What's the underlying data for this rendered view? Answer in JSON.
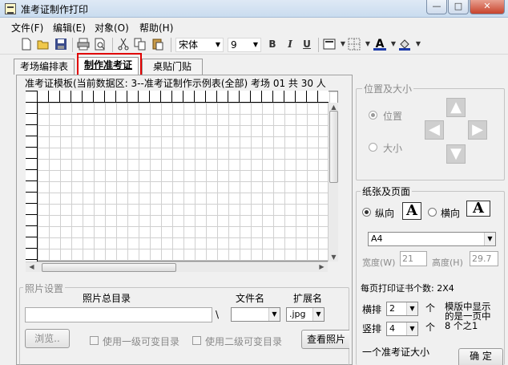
{
  "window": {
    "title": "准考证制作打印",
    "minimize": "—",
    "maximize": "□",
    "close": "✕"
  },
  "menu": [
    "文件(F)",
    "编辑(E)",
    "对象(O)",
    "帮助(H)"
  ],
  "toolbar": {
    "font": "宋体",
    "size": "9",
    "bold": "B",
    "italic": "I",
    "underline": "U",
    "font_color": "A"
  },
  "icons": {
    "new": "new-file-icon",
    "open": "open-folder-icon",
    "save": "save-icon",
    "print": "print-icon",
    "preview": "print-preview-icon",
    "cut": "cut-icon",
    "copy": "copy-icon",
    "paste": "paste-icon",
    "border": "border-icon",
    "grid": "grid-icon",
    "fill": "fill-color-icon"
  },
  "tabs": [
    "考场编排表",
    "制作准考证",
    "桌贴门贴"
  ],
  "active_tab": "制作准考证",
  "template_header": "准考证模板(当前数据区: 3--准考证制作示例表(全部)   考场 01 共 30 人",
  "photo": {
    "group_label": "照片设置",
    "dir_label": "照片总目录",
    "file_label": "文件名",
    "ext_label": "扩展名",
    "ext_value": ".jpg",
    "slash": "\\",
    "browse": "浏览..",
    "use_level1": "使用一级可变目录",
    "use_level2": "使用二级可变目录",
    "view_photo": "查看照片"
  },
  "position": {
    "group_label": "位置及大小",
    "pos": "位置",
    "size": "大小"
  },
  "paper": {
    "group_label": "纸张及页面",
    "portrait": "纵向",
    "landscape": "横向",
    "orientation_icon": "A",
    "paper_size": "A4",
    "width_label": "宽度(W)",
    "width": "21",
    "height_label": "高度(H)",
    "height": "29.7",
    "per_page": "每页打印证书个数: 2X4",
    "cols_label": "横排",
    "cols": "2",
    "rows_label": "竖排",
    "rows": "4",
    "unit": "个",
    "note1": "模版中显示",
    "note2": "的是一页中",
    "note3": "8 个之1",
    "card_size": "一个准考证大小",
    "confirm": "确 定"
  }
}
